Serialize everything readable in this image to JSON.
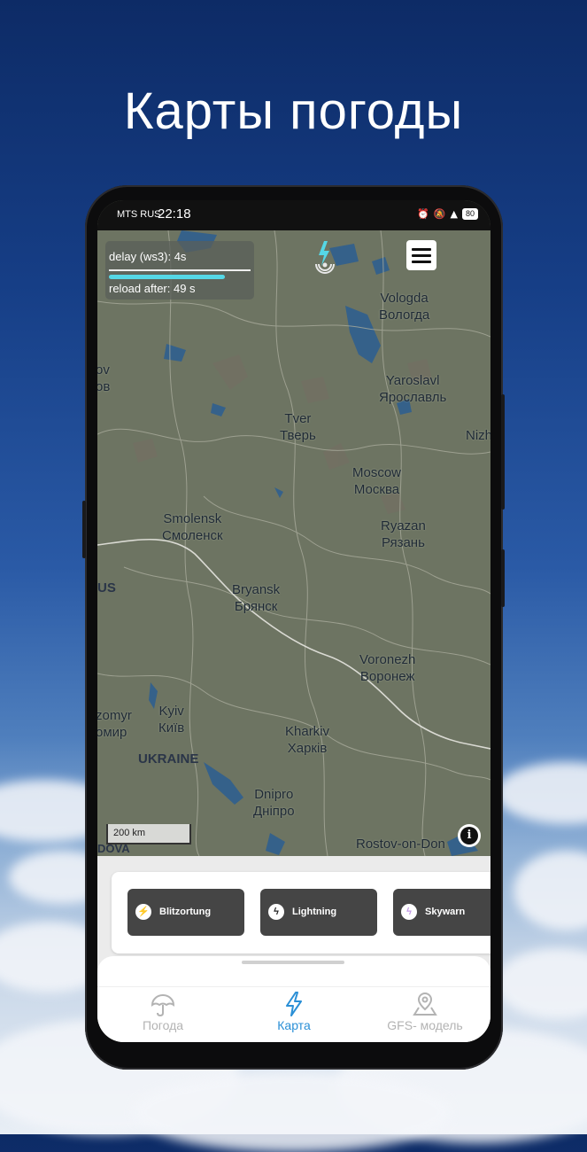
{
  "hero": {
    "title": "Карты погоды"
  },
  "status_bar": {
    "carrier": "MTS RUS",
    "time": "22:18",
    "battery": "80"
  },
  "map": {
    "delay_text": "delay (ws3): 4s",
    "reload_text": "reload after: 49 s",
    "reload_progress": 0.82,
    "scale_label": "200 km",
    "cities": [
      {
        "en": "Vologda",
        "ru": "Вологда"
      },
      {
        "en": "Yaroslavl",
        "ru": "Ярославль"
      },
      {
        "en": "Tver",
        "ru": "Тверь"
      },
      {
        "en": "Moscow",
        "ru": "Москва"
      },
      {
        "en": "Smolensk",
        "ru": "Смоленск"
      },
      {
        "en": "Ryazan",
        "ru": "Рязань"
      },
      {
        "en": "Bryansk",
        "ru": "Брянск"
      },
      {
        "en": "Voronezh",
        "ru": "Воронеж"
      },
      {
        "en": "Kyiv",
        "ru": "Київ"
      },
      {
        "en": "Kharkiv",
        "ru": "Харків"
      },
      {
        "en": "Dnipro",
        "ru": "Дніпро"
      },
      {
        "en": "Rostov-on-Don",
        "ru": ""
      }
    ],
    "edge_labels": {
      "nizh": "Nizh",
      "ov": "ov",
      "ov_ru": "ов",
      "us": "US",
      "zomyr": "zomyr",
      "omir": "омир",
      "dova": "DOVA"
    },
    "country_label": "UKRAINE",
    "accent_color": "#55d7e6"
  },
  "sources": [
    {
      "label": "Blitzortung",
      "icon": "lightning-yellow-icon",
      "color": "#f3c623"
    },
    {
      "label": "Lightning",
      "icon": "lightning-white-icon",
      "color": "#222222"
    },
    {
      "label": "Skywarn",
      "icon": "lightning-purple-icon",
      "color": "#c39be6"
    }
  ],
  "nav": {
    "items": [
      {
        "label": "Погода",
        "icon": "umbrella-icon",
        "active": false
      },
      {
        "label": "Карта",
        "icon": "lightning-icon",
        "active": true
      },
      {
        "label": "GFS- модель",
        "icon": "map-pin-icon",
        "active": false
      }
    ],
    "active_color": "#2a8fd6",
    "inactive_color": "#b3b3b3"
  }
}
